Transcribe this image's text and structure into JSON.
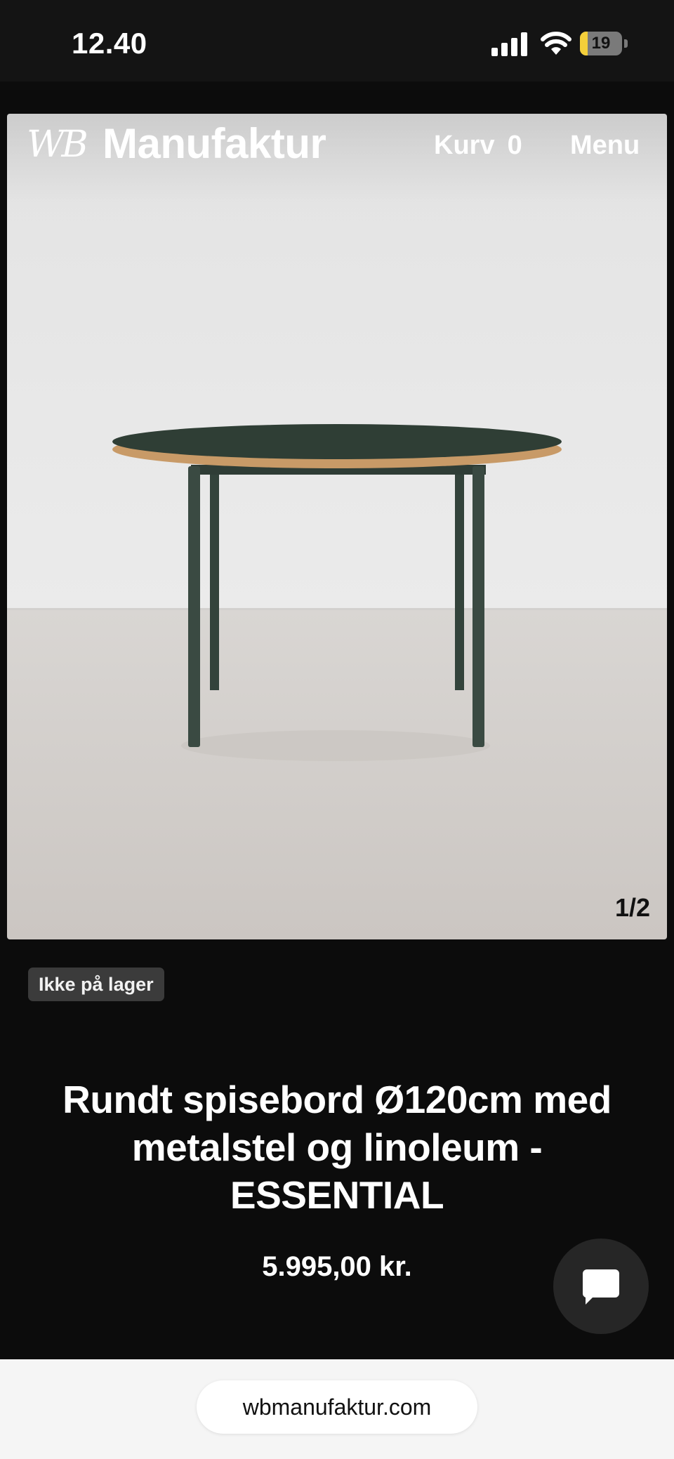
{
  "status_bar": {
    "time": "12.40",
    "battery_level": "19",
    "battery_fraction": 0.19,
    "icons": [
      "cellular-signal-icon",
      "wifi-icon",
      "battery-icon"
    ]
  },
  "header": {
    "logo_monogram": "WB",
    "logo_text": "Manufaktur",
    "cart_label": "Kurv",
    "cart_count": "0",
    "menu_label": "Menu"
  },
  "gallery": {
    "image_subject": "round dining table with dark green linoleum top and metal frame",
    "counter": "1/2"
  },
  "product": {
    "stock_status": "Ikke på lager",
    "title": "Rundt spisebord Ø120cm med metalstel og linoleum - ESSENTIAL",
    "price": "5.995,00 kr."
  },
  "chat": {
    "icon": "chat-bubble-icon"
  },
  "browser": {
    "url": "wbmanufaktur.com"
  },
  "colors": {
    "page_background": "#0c0c0c",
    "status_bar": "#141414",
    "badge_background": "#3b3b3b",
    "chat_button": "#262626",
    "battery_accent": "#f4cf3a",
    "table_top": "#2f3e35",
    "table_edge": "#c89a67",
    "frame": "#3a4a42"
  }
}
